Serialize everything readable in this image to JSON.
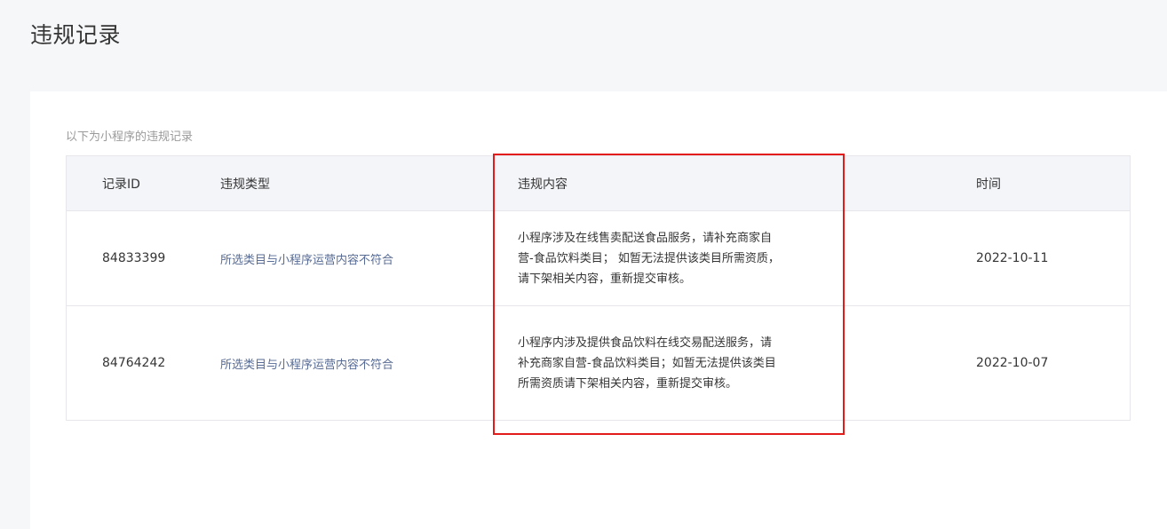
{
  "page": {
    "title": "违规记录",
    "description": "以下为小程序的违规记录"
  },
  "table": {
    "columns": {
      "id": "记录ID",
      "type": "违规类型",
      "content": "违规内容",
      "time": "时间"
    },
    "rows": [
      {
        "id": "84833399",
        "type": "所选类目与小程序运营内容不符合",
        "content": "小程序涉及在线售卖配送食品服务，请补充商家自营-食品饮料类目； 如暂无法提供该类目所需资质，请下架相关内容，重新提交审核。",
        "time": "2022-10-11"
      },
      {
        "id": "84764242",
        "type": "所选类目与小程序运营内容不符合",
        "content": "小程序内涉及提供食品饮料在线交易配送服务，请补充商家自营-食品饮料类目；如暂无法提供该类目所需资质请下架相关内容，重新提交审核。",
        "time": "2022-10-07"
      }
    ]
  },
  "annotation": {
    "highlight_color": "#e21b1b"
  }
}
